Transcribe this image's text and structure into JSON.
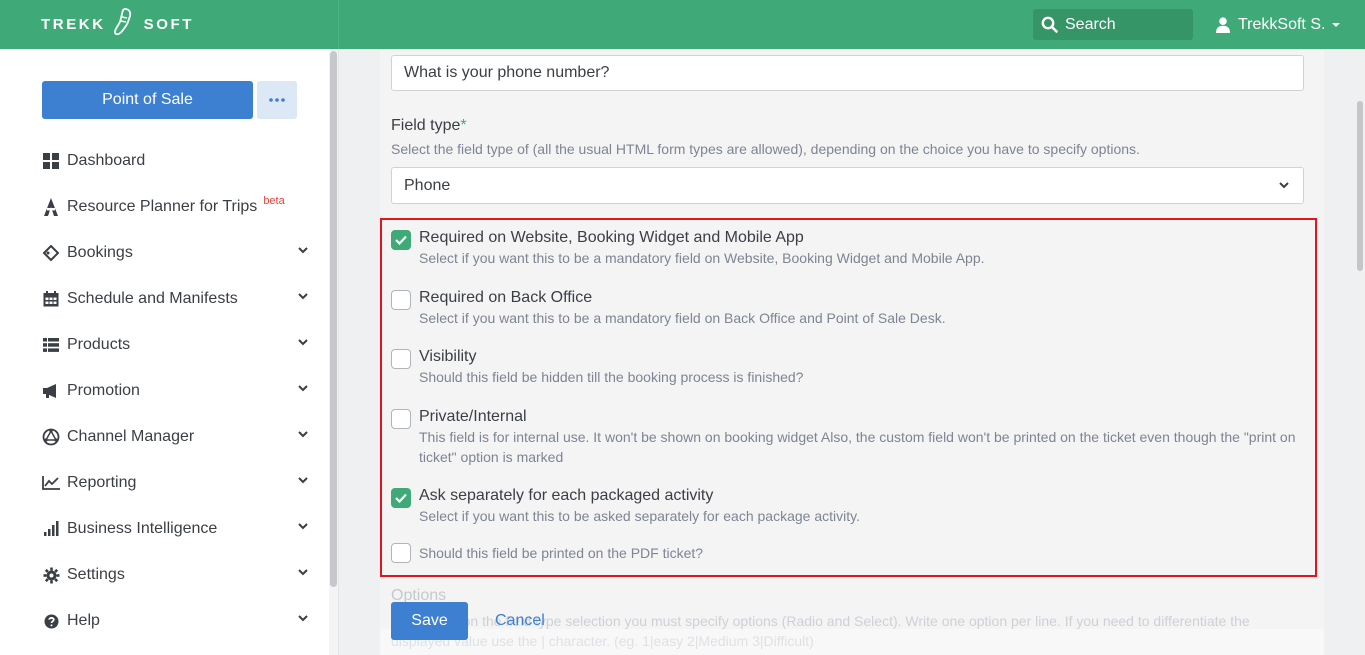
{
  "header": {
    "brand_left": "TREKK",
    "brand_right": "SOFT",
    "search_label": "Search",
    "user_name": "TrekkSoft S."
  },
  "sidebar": {
    "pos_button": "Point of Sale",
    "more_button": "•••",
    "items": [
      {
        "label": "Dashboard",
        "icon": "grid-icon",
        "expandable": false
      },
      {
        "label": "Resource Planner for Trips",
        "icon": "hiker-icon",
        "expandable": false,
        "badge": "beta"
      },
      {
        "label": "Bookings",
        "icon": "ticket-icon",
        "expandable": true
      },
      {
        "label": "Schedule and Manifests",
        "icon": "calendar-icon",
        "expandable": true
      },
      {
        "label": "Products",
        "icon": "list-icon",
        "expandable": true
      },
      {
        "label": "Promotion",
        "icon": "megaphone-icon",
        "expandable": true
      },
      {
        "label": "Channel Manager",
        "icon": "network-icon",
        "expandable": true
      },
      {
        "label": "Reporting",
        "icon": "line-chart-icon",
        "expandable": true
      },
      {
        "label": "Business Intelligence",
        "icon": "bar-chart-icon",
        "expandable": true
      },
      {
        "label": "Settings",
        "icon": "gear-icon",
        "expandable": true
      },
      {
        "label": "Help",
        "icon": "question-icon",
        "expandable": true
      }
    ]
  },
  "form": {
    "question_value": "What is your phone number?",
    "field_type_label": "Field type",
    "required_mark": "*",
    "field_type_help": "Select the field type of (all the usual HTML form types are allowed), depending on the choice you have to specify options.",
    "field_type_value": "Phone",
    "checkboxes": [
      {
        "title": "Required on Website, Booking Widget and Mobile App",
        "desc": "Select if you want this to be a mandatory field on Website, Booking Widget and Mobile App.",
        "checked": true
      },
      {
        "title": "Required on Back Office",
        "desc": "Select if you want this to be a mandatory field on Back Office and Point of Sale Desk.",
        "checked": false
      },
      {
        "title": "Visibility",
        "desc": "Should this field be hidden till the booking process is finished?",
        "checked": false
      },
      {
        "title": "Private/Internal",
        "desc": "This field is for internal use. It won't be shown on booking widget Also, the custom field won't be printed on the ticket even though the \"print on ticket\" option is marked",
        "checked": false
      },
      {
        "title": "Ask separately for each packaged activity",
        "desc": "Select if you want this to be asked separately for each package activity.",
        "checked": true
      },
      {
        "title": "Should this field be printed on the PDF ticket?",
        "desc": "",
        "checked": false
      }
    ],
    "options_label": "Options",
    "options_help": "Depending on the field type selection you must specify options (Radio and Select). Write one option per line. If you need to differentiate the displayed value use the | character. (eg. 1|easy 2|Medium 3|Difficult)",
    "save_label": "Save",
    "cancel_label": "Cancel"
  },
  "colors": {
    "brand_green": "#3faa78",
    "primary_blue": "#3d7fd1",
    "highlight_red": "#e3141e"
  }
}
